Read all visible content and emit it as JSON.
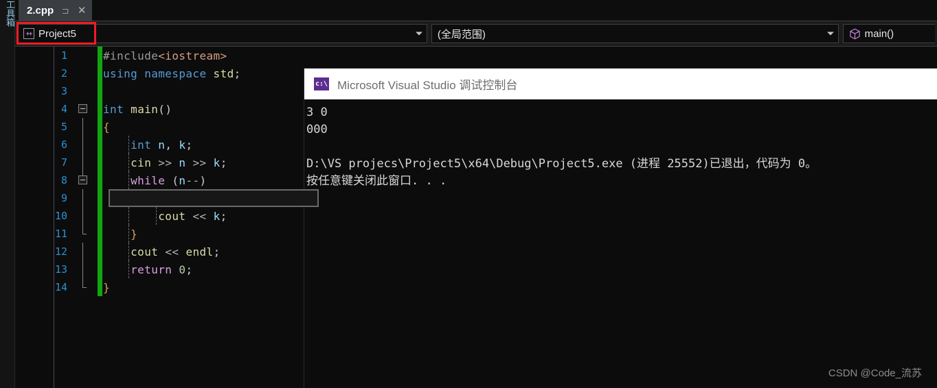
{
  "app": {
    "tool_rail_label": "工具箱"
  },
  "tab": {
    "label": "2.cpp",
    "pin_icon": "⊐",
    "close_icon": "✕"
  },
  "nav_bar": {
    "project": "Project5",
    "project_icon": "++",
    "scope": "(全局范围)",
    "member": "main()",
    "arrow": "▾"
  },
  "annotation": {
    "color": "#ef1c24"
  },
  "editor": {
    "change_bar_color": "#11a611",
    "current_line": 9,
    "lines": [
      {
        "n": "1",
        "indent": 0
      },
      {
        "n": "2",
        "indent": 0
      },
      {
        "n": "3",
        "indent": 0
      },
      {
        "n": "4",
        "indent": 0
      },
      {
        "n": "5",
        "indent": 0
      },
      {
        "n": "6",
        "indent": 0
      },
      {
        "n": "7",
        "indent": 0
      },
      {
        "n": "8",
        "indent": 0
      },
      {
        "n": "9",
        "indent": 0
      },
      {
        "n": "10",
        "indent": 0
      },
      {
        "n": "11",
        "indent": 0
      },
      {
        "n": "12",
        "indent": 0
      },
      {
        "n": "13",
        "indent": 0
      },
      {
        "n": "14",
        "indent": 0
      }
    ],
    "code": [
      "#include<iostream>",
      "using namespace std;",
      "",
      "int main()",
      "{",
      "    int n, k;",
      "    cin >> n >> k;",
      "    while (n--)",
      "    {",
      "        cout << k;",
      "    }",
      "    cout << endl;",
      "    return 0;",
      "}"
    ]
  },
  "console": {
    "title": "Microsoft Visual Studio 调试控制台",
    "icon_label": "c:\\",
    "output_lines": [
      "3 0",
      "000",
      "",
      "D:\\VS projecs\\Project5\\x64\\Debug\\Project5.exe (进程 25552)已退出，代码为 0。",
      "按任意键关闭此窗口. . ."
    ]
  },
  "watermark": {
    "text": "CSDN @Code_流苏"
  }
}
